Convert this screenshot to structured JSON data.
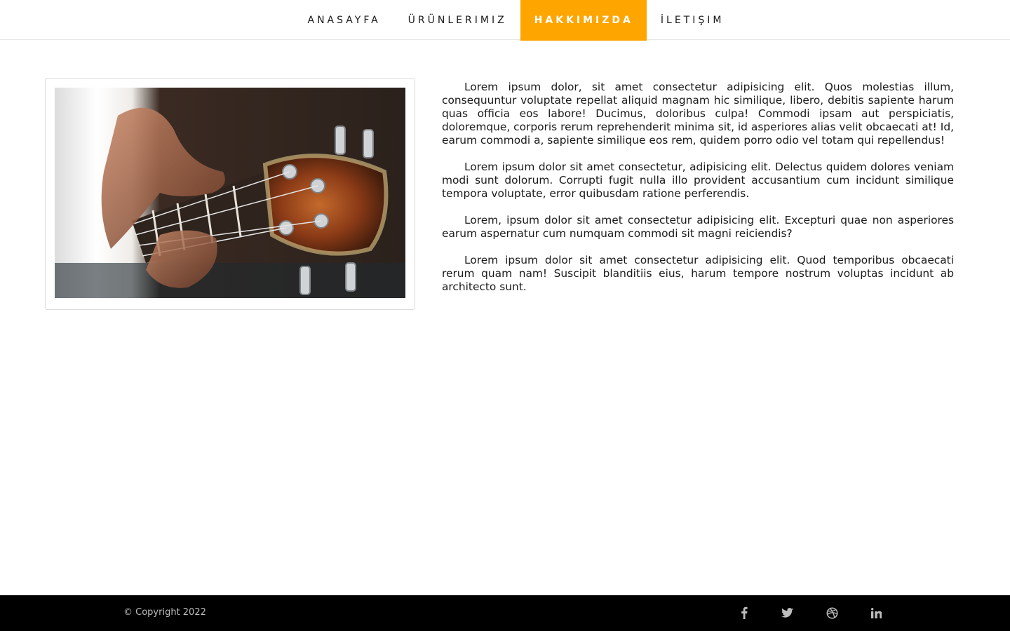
{
  "nav": {
    "items": [
      {
        "label": "ANASAYFA",
        "active": false
      },
      {
        "label": "ÜRÜNLERIMIZ",
        "active": false
      },
      {
        "label": "HAKKIMIZDA",
        "active": true
      },
      {
        "label": "İLETIŞIM",
        "active": false
      }
    ],
    "active_color": "#ffa500"
  },
  "about": {
    "image_subject": "bass guitar headstock close-up",
    "paragraphs": [
      "Lorem ipsum dolor, sit amet consectetur adipisicing elit. Quos molestias illum, consequuntur voluptate repellat aliquid magnam hic similique, libero, debitis sapiente harum quas officia eos labore! Ducimus, doloribus culpa! Commodi ipsam aut perspiciatis, doloremque, corporis rerum reprehenderit minima sit, id asperiores alias velit obcaecati at! Id, earum commodi a, sapiente similique eos rem, quidem porro odio vel totam qui repellendus!",
      "Lorem ipsum dolor sit amet consectetur, adipisicing elit. Delectus quidem dolores veniam modi sunt dolorum. Corrupti fugit nulla illo provident accusantium cum incidunt similique tempora voluptate, error quibusdam ratione perferendis.",
      "Lorem, ipsum dolor sit amet consectetur adipisicing elit. Excepturi quae non asperiores earum aspernatur cum numquam commodi sit magni reiciendis?",
      "Lorem ipsum dolor sit amet consectetur adipisicing elit. Quod temporibus obcaecati rerum quam nam! Suscipit blanditiis eius, harum tempore nostrum voluptas incidunt ab architecto sunt."
    ]
  },
  "footer": {
    "copyright": "© Copyright 2022",
    "social_icons": [
      "facebook-icon",
      "twitter-icon",
      "dribbble-icon",
      "linkedin-icon"
    ]
  }
}
